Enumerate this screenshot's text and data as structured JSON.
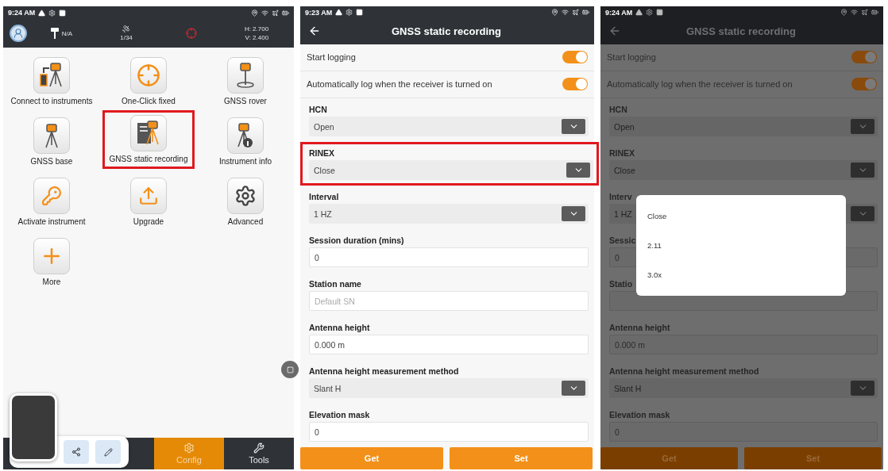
{
  "home_screen": {
    "status_bar": {
      "time": "9:24 AM"
    },
    "header": {
      "antenna": "N/A",
      "satellites": "1/34",
      "height": "H: 2.700",
      "vertical": "V: 2.400"
    },
    "tiles": [
      {
        "label": "Connect to instruments",
        "selected": false
      },
      {
        "label": "One-Click fixed",
        "selected": false
      },
      {
        "label": "GNSS rover",
        "selected": false
      },
      {
        "label": "GNSS base",
        "selected": false
      },
      {
        "label": "GNSS static recording",
        "selected": true
      },
      {
        "label": "Instrument info",
        "selected": false
      },
      {
        "label": "Activate instrument",
        "selected": false
      },
      {
        "label": "Upgrade",
        "selected": false
      },
      {
        "label": "Advanced",
        "selected": false
      },
      {
        "label": "More",
        "selected": false
      }
    ],
    "bottom_nav": [
      {
        "label": "Config",
        "selected": true
      },
      {
        "label": "Tools",
        "selected": false
      }
    ]
  },
  "recording_screen": {
    "status_bar": {
      "time": "9:23 AM"
    },
    "title": "GNSS static recording",
    "dimmed": false,
    "toggles": [
      {
        "label": "Start logging",
        "on": true
      },
      {
        "label": "Automatically log when the receiver is turned on",
        "on": true
      }
    ],
    "fields": [
      {
        "kind": "select",
        "label": "HCN",
        "value": "Open"
      },
      {
        "kind": "select",
        "label": "RINEX",
        "value": "Close",
        "highlighted": true
      },
      {
        "kind": "select",
        "label": "Interval",
        "value": "1 HZ"
      },
      {
        "kind": "input",
        "label": "Session duration (mins)",
        "value": "0"
      },
      {
        "kind": "input",
        "label": "Station name",
        "placeholder": "Default SN"
      },
      {
        "kind": "input",
        "label": "Antenna height",
        "value": "0.000 m"
      },
      {
        "kind": "select",
        "label": "Antenna height measurement method",
        "value": "Slant H"
      },
      {
        "kind": "input",
        "label": "Elevation mask",
        "value": "0"
      }
    ],
    "buttons": [
      "Get",
      "Set"
    ]
  },
  "dimmed_screen": {
    "status_bar": {
      "time": "9:24 AM"
    },
    "title": "GNSS static recording",
    "dimmed": true,
    "toggles": [
      {
        "label": "Start logging",
        "on": true
      },
      {
        "label": "Automatically log when the receiver is turned on",
        "on": true
      }
    ],
    "fields": [
      {
        "kind": "select",
        "label": "HCN",
        "value": "Open"
      },
      {
        "kind": "select",
        "label": "RINEX",
        "value": "Close"
      },
      {
        "kind": "select",
        "label": "Interv",
        "value": "1 HZ"
      },
      {
        "kind": "input",
        "label": "Sessic",
        "value": "0"
      },
      {
        "kind": "input",
        "label": "Statio"
      },
      {
        "kind": "input",
        "label": "Antenna height",
        "value": "0.000 m"
      },
      {
        "kind": "select",
        "label": "Antenna height measurement method",
        "value": "Slant H"
      },
      {
        "kind": "input",
        "label": "Elevation mask",
        "value": "0"
      }
    ],
    "buttons": [
      "Get",
      "Set"
    ],
    "dialog": {
      "options": [
        "Close",
        "2.11",
        "3.0x"
      ]
    }
  }
}
